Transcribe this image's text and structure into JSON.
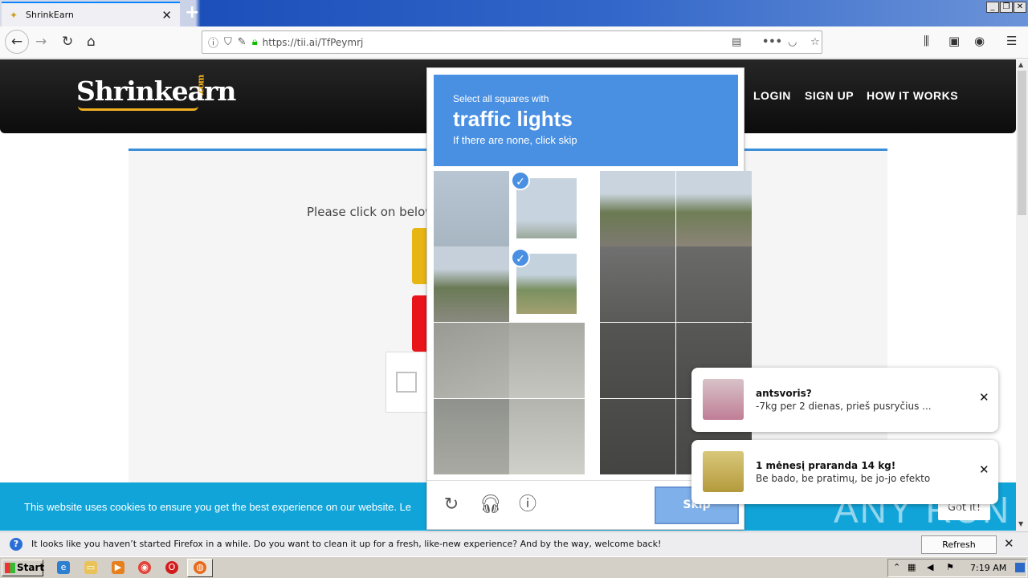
{
  "browser": {
    "tab_title": "ShrinkEarn",
    "url": "https://tii.ai/TfPeymrj",
    "new_tab": "+",
    "tab_close": "✕"
  },
  "site": {
    "logo": "Shrinkearn",
    "logo_com": ".com",
    "menu": [
      "LOGIN",
      "SIGN UP",
      "HOW IT WORKS"
    ],
    "instruction": "Please click on below"
  },
  "captcha": {
    "line1": "Select all squares with",
    "target": "traffic lights",
    "line3": "If there are none, click skip",
    "skip_label": "Skip"
  },
  "cookie": {
    "text": "This website uses cookies to ensure you get the best experience on our website. Le",
    "button": "Got it!"
  },
  "toasts": [
    {
      "title": "antsvoris?",
      "body": "-7kg per 2 dienas, prieš pusryčius ..."
    },
    {
      "title": "1 mėnesį praranda 14 kg!",
      "body": "Be bado, be pratimų, be jo-jo efekto"
    }
  ],
  "notification": {
    "text": "It looks like you haven’t started Firefox in a while. Do you want to clean it up for a fresh, like-new experience? And by the way, welcome back!",
    "button": "Refresh Firefox…"
  },
  "taskbar": {
    "start": "Start",
    "time": "7:19 AM"
  },
  "watermark": "ANY RUN",
  "colors": {
    "captcha_blue": "#4a90e2",
    "cookie_bar": "#11a4d8",
    "logo_accent": "#f2b01e"
  }
}
